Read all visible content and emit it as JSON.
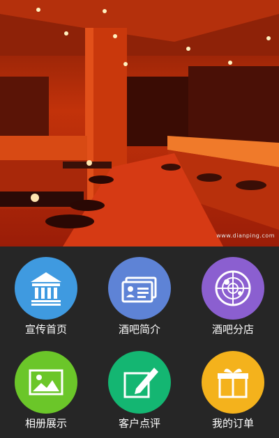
{
  "hero": {
    "watermark": "www.dianping.com"
  },
  "menu": {
    "items": [
      {
        "label": "宣传首页",
        "icon": "bank-icon",
        "color": "#3f9ae0"
      },
      {
        "label": "酒吧简介",
        "icon": "id-card-icon",
        "color": "#5e83d6"
      },
      {
        "label": "酒吧分店",
        "icon": "radar-icon",
        "color": "#8b5fd0"
      },
      {
        "label": "相册展示",
        "icon": "image-icon",
        "color": "#6bc629"
      },
      {
        "label": "客户点评",
        "icon": "pen-icon",
        "color": "#14b672"
      },
      {
        "label": "我的订单",
        "icon": "gift-icon",
        "color": "#f4b21c"
      }
    ]
  }
}
